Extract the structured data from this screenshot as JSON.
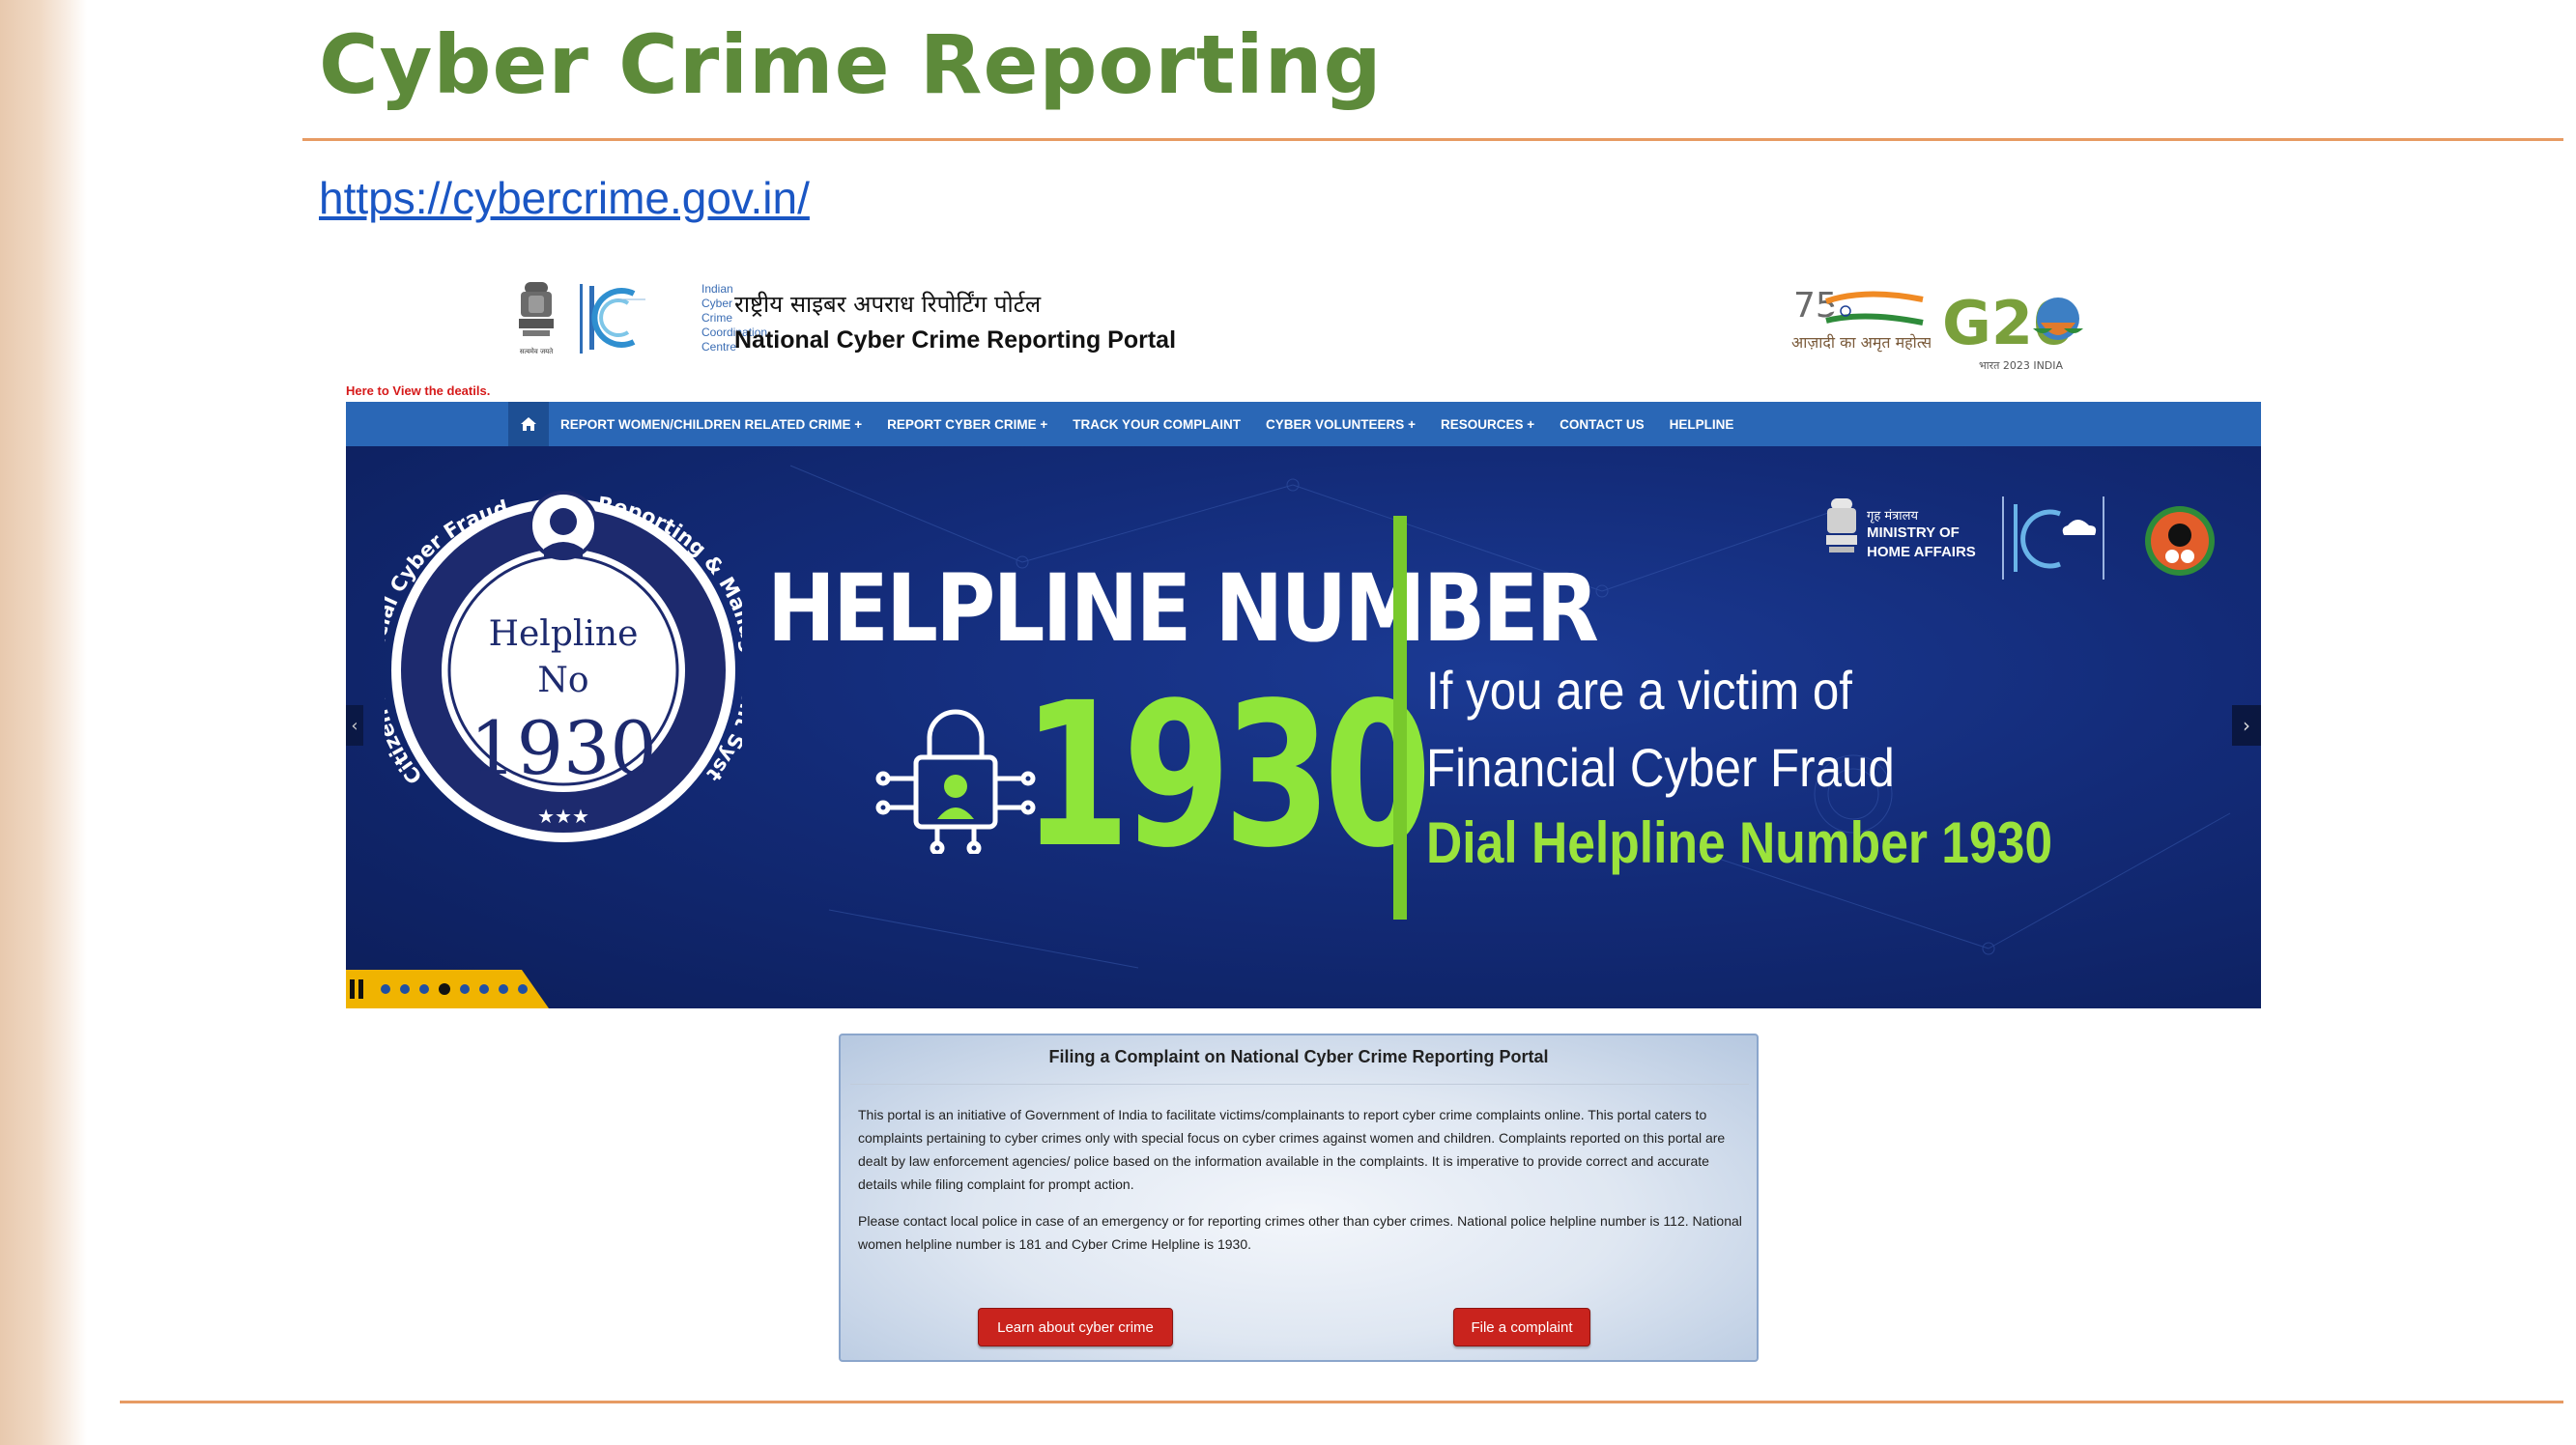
{
  "slide": {
    "title": "Cyber Crime Reporting",
    "url": "https://cybercrime.gov.in/"
  },
  "header": {
    "i4c_lines": [
      "Indian",
      "Cyber",
      "Crime",
      "Coordination",
      "Centre"
    ],
    "portal_title_hindi": "राष्ट्रीय साइबर अपराध रिपोर्टिंग पोर्टल",
    "portal_title_english": "National Cyber Crime Reporting Portal",
    "emblem_motto": "सत्यमेव जयते",
    "azadi_text": "आज़ादी का अमृत महोत्सव",
    "g20_text": "G20",
    "g20_sub": "भारत 2023 INDIA"
  },
  "notice": "Here to View the deatils.",
  "nav": {
    "items": [
      "REPORT WOMEN/CHILDREN RELATED CRIME +",
      "REPORT CYBER CRIME +",
      "TRACK YOUR COMPLAINT",
      "CYBER VOLUNTEERS +",
      "RESOURCES +",
      "CONTACT US",
      "HELPLINE"
    ]
  },
  "banner": {
    "badge_ring_left": "Citizen Financial Cyber Fraud",
    "badge_ring_right": "Reporting & Management System",
    "badge_helpline": "Helpline",
    "badge_no": "No",
    "badge_number": "1930",
    "badge_stars": "★★★",
    "heading": "HELPLINE NUMBER",
    "number": "1930",
    "line1": "If you are a victim of",
    "line2": "Financial Cyber Fraud",
    "dial": "Dial Helpline Number 1930",
    "mha_hindi": "गृह मंत्रालय",
    "mha_line1": "MINISTRY OF",
    "mha_line2": "HOME AFFAIRS",
    "slide_count": 8,
    "active_slide": 4
  },
  "info_panel": {
    "title": "Filing a Complaint on National Cyber Crime Reporting Portal",
    "paragraph1": "This portal is an initiative of Government of India to facilitate victims/complainants to report cyber crime complaints online. This portal caters to complaints pertaining to cyber crimes only with special focus on cyber crimes against women and children. Complaints reported on this portal are dealt by law enforcement agencies/ police based on the information available in the complaints. It is imperative to provide correct and accurate details while filing complaint for prompt action.",
    "paragraph2": "Please contact local police in case of an emergency or for reporting crimes other than cyber crimes. National police helpline number is 112. National women helpline number is 181 and Cyber Crime Helpline is 1930.",
    "learn_button": "Learn about cyber crime",
    "file_button": "File a complaint"
  },
  "colors": {
    "title_green": "#5d8a3a",
    "rule_orange": "#e79b63",
    "nav_blue": "#2a67b6",
    "banner_navy": "#132b78",
    "accent_green": "#8fe53a",
    "button_red": "#c9231d"
  }
}
